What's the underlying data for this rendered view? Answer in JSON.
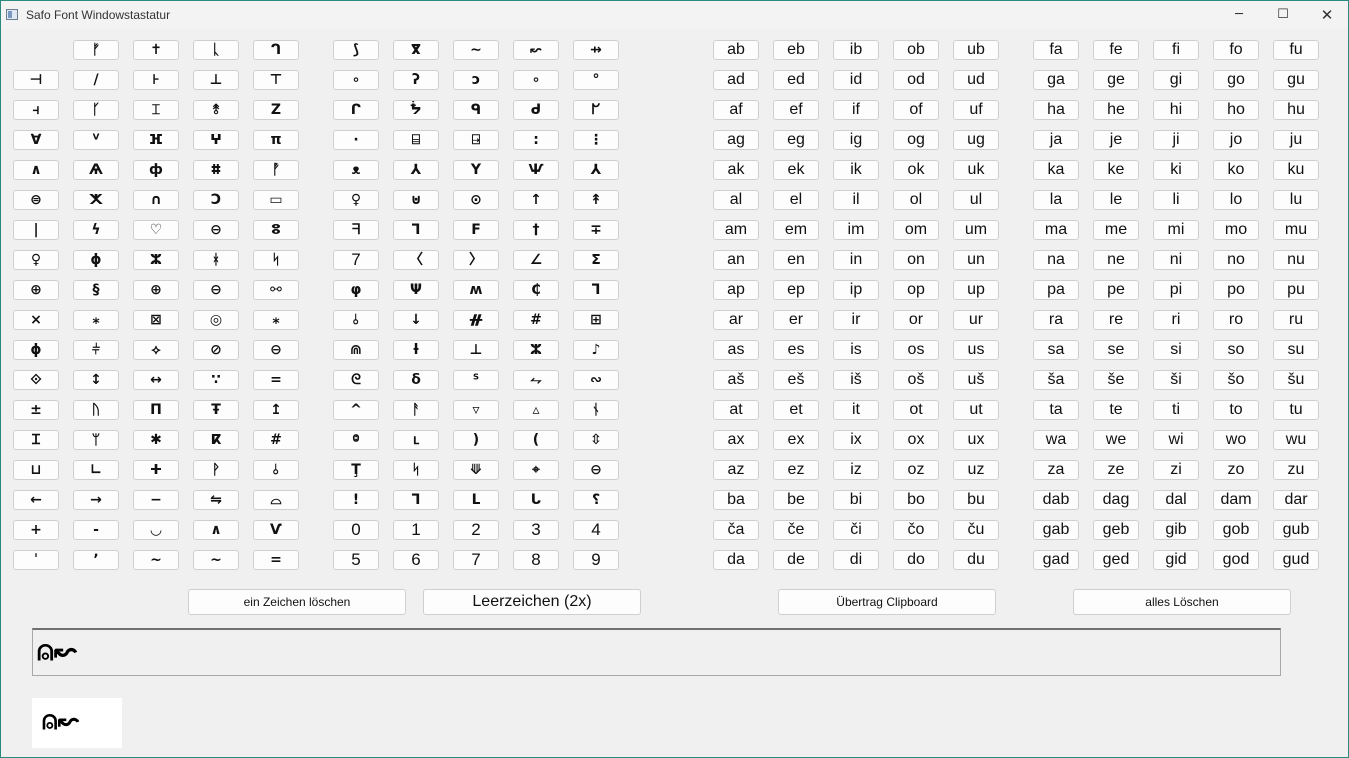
{
  "window": {
    "title": "Safo Font Windowstastatur",
    "accent": "#2b8a7e"
  },
  "titlebar": {
    "minimize": "─",
    "maximize": "☐",
    "close": "✕"
  },
  "glyph_rows": [
    [
      "",
      "ᚠ",
      "✝",
      "ᚳ",
      "ᒉ",
      "⟆",
      "ⴳ",
      "∼",
      "↜",
      "⇸"
    ],
    [
      "⊣",
      "/",
      "⊦",
      "⊥",
      "⊤",
      "∘",
      "ʔ",
      "ɔ",
      "∘",
      "°"
    ],
    [
      "⫞",
      "ᚴ",
      "⌶",
      "⥉",
      "Z",
      "ᒋ",
      "ᖭ",
      "ᑫ",
      "ᑯ",
      "ᖸ"
    ],
    [
      "∀",
      "ⱽ",
      "ⴼ",
      "ⵖ",
      "π",
      "·",
      "⌸",
      "⍈",
      ":",
      "⋮"
    ],
    [
      "∧",
      "Ѧ",
      "ф",
      "ⵌ",
      "ᚡ",
      "ᴥ",
      "⅄",
      "Y",
      "Ѱ",
      "⅄"
    ],
    [
      "⊜",
      "ⵅ",
      "∩",
      "Ↄ",
      "▭",
      "♀",
      "⊍",
      "⊙",
      "↑",
      "↟"
    ],
    [
      "|",
      "ϟ",
      "♡",
      "⊖",
      "ⵓ",
      "ᖷ",
      "ᒣ",
      "F",
      "†",
      "∓"
    ],
    [
      "♀",
      "ɸ",
      "ⵣ",
      "ᚼ",
      "ᛋ",
      "7",
      "〈",
      "〉",
      "∠",
      "ⵉ"
    ],
    [
      "⊕",
      "§",
      "⊕",
      "⊖",
      "⚯",
      "φ",
      "Ψ",
      "ʍ",
      "₵",
      "ᒣ"
    ],
    [
      "×",
      "⁎",
      "⊠",
      "◎",
      "⁎",
      "⫰",
      "↓",
      "ᚌ",
      "#",
      "⊞"
    ],
    [
      "ϕ",
      "⫩",
      "⟡",
      "⊘",
      "⊖",
      "⋒",
      "ƚ",
      "⊥",
      "ⵣ",
      "♪"
    ],
    [
      "⟐",
      "↕",
      "↔",
      "∵",
      "=",
      "ᘓ",
      "δ",
      "ᔆ",
      "⥊",
      "∾"
    ],
    [
      "±",
      "ᚢ",
      "Π",
      "Ŧ",
      "↥",
      "^",
      "ᚨ",
      "▿",
      "▵",
      "ᚾ"
    ],
    [
      "Ɪ",
      "ᛘ",
      "✱",
      "ⴽ",
      "#",
      "ⱉ",
      "ⳑ",
      ")",
      "(",
      "⇳"
    ],
    [
      "⊔",
      "∟",
      "ⵜ",
      "ᚹ",
      "⫰",
      "Ţ",
      "ᛋ",
      "⟱",
      "⌖",
      "⊖"
    ],
    [
      "←",
      "→",
      "−",
      "⇋",
      "⌓",
      "!",
      "ᒣ",
      "ᒪ",
      "ᒐ",
      "⸮"
    ],
    [
      "+",
      "-",
      "◡",
      "∧",
      "Ѵ",
      "0",
      "1",
      "2",
      "3",
      "4"
    ],
    [
      "ˈ",
      "ʼ",
      "~",
      "~",
      "=",
      "5",
      "6",
      "7",
      "8",
      "9"
    ]
  ],
  "syllable_rows": [
    [
      "ab",
      "eb",
      "ib",
      "ob",
      "ub",
      "fa",
      "fe",
      "fi",
      "fo",
      "fu"
    ],
    [
      "ad",
      "ed",
      "id",
      "od",
      "ud",
      "ga",
      "ge",
      "gi",
      "go",
      "gu"
    ],
    [
      "af",
      "ef",
      "if",
      "of",
      "uf",
      "ha",
      "he",
      "hi",
      "ho",
      "hu"
    ],
    [
      "ag",
      "eg",
      "ig",
      "og",
      "ug",
      "ja",
      "je",
      "ji",
      "jo",
      "ju"
    ],
    [
      "ak",
      "ek",
      "ik",
      "ok",
      "uk",
      "ka",
      "ke",
      "ki",
      "ko",
      "ku"
    ],
    [
      "al",
      "el",
      "il",
      "ol",
      "ul",
      "la",
      "le",
      "li",
      "lo",
      "lu"
    ],
    [
      "am",
      "em",
      "im",
      "om",
      "um",
      "ma",
      "me",
      "mi",
      "mo",
      "mu"
    ],
    [
      "an",
      "en",
      "in",
      "on",
      "un",
      "na",
      "ne",
      "ni",
      "no",
      "nu"
    ],
    [
      "ap",
      "ep",
      "ip",
      "op",
      "up",
      "pa",
      "pe",
      "pi",
      "po",
      "pu"
    ],
    [
      "ar",
      "er",
      "ir",
      "or",
      "ur",
      "ra",
      "re",
      "ri",
      "ro",
      "ru"
    ],
    [
      "as",
      "es",
      "is",
      "os",
      "us",
      "sa",
      "se",
      "si",
      "so",
      "su"
    ],
    [
      "aš",
      "eš",
      "iš",
      "oš",
      "uš",
      "ša",
      "še",
      "ši",
      "šo",
      "šu"
    ],
    [
      "at",
      "et",
      "it",
      "ot",
      "ut",
      "ta",
      "te",
      "ti",
      "to",
      "tu"
    ],
    [
      "ax",
      "ex",
      "ix",
      "ox",
      "ux",
      "wa",
      "we",
      "wi",
      "wo",
      "wu"
    ],
    [
      "az",
      "ez",
      "iz",
      "oz",
      "uz",
      "za",
      "ze",
      "zi",
      "zo",
      "zu"
    ],
    [
      "ba",
      "be",
      "bi",
      "bo",
      "bu",
      "dab",
      "dag",
      "dal",
      "dam",
      "dar"
    ],
    [
      "ča",
      "če",
      "či",
      "čo",
      "ču",
      "gab",
      "geb",
      "gib",
      "gob",
      "gub"
    ],
    [
      "da",
      "de",
      "di",
      "do",
      "du",
      "gad",
      "ged",
      "gid",
      "god",
      "gud"
    ]
  ],
  "actions": {
    "delete_char": "ein Zeichen löschen",
    "space": "Leerzeichen (2x)",
    "clipboard": "Übertrag Clipboard",
    "clear_all": "alles Löschen"
  },
  "output": {
    "text": "⍝↜"
  },
  "preview": {
    "text": "⍝↜"
  }
}
